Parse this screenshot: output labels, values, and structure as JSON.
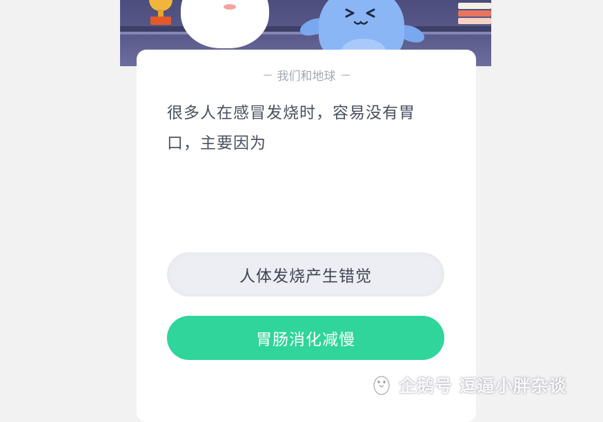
{
  "header": {
    "section_label": "我们和地球"
  },
  "question": {
    "text": "很多人在感冒发烧时，容易没有胃口，主要因为"
  },
  "options": [
    {
      "label": "人体发烧产生错觉",
      "state": "default"
    },
    {
      "label": "胃肠消化减慢",
      "state": "selected-correct"
    }
  ],
  "watermark": {
    "text": "企鹅号 逗逼小胖杂谈"
  },
  "colors": {
    "banner": "#4c4d7c",
    "correct": "#2fd59a",
    "option_default": "#eceef3",
    "question_text": "#4a5060"
  },
  "icons": {
    "watermark_logo": "penguin-icon"
  }
}
